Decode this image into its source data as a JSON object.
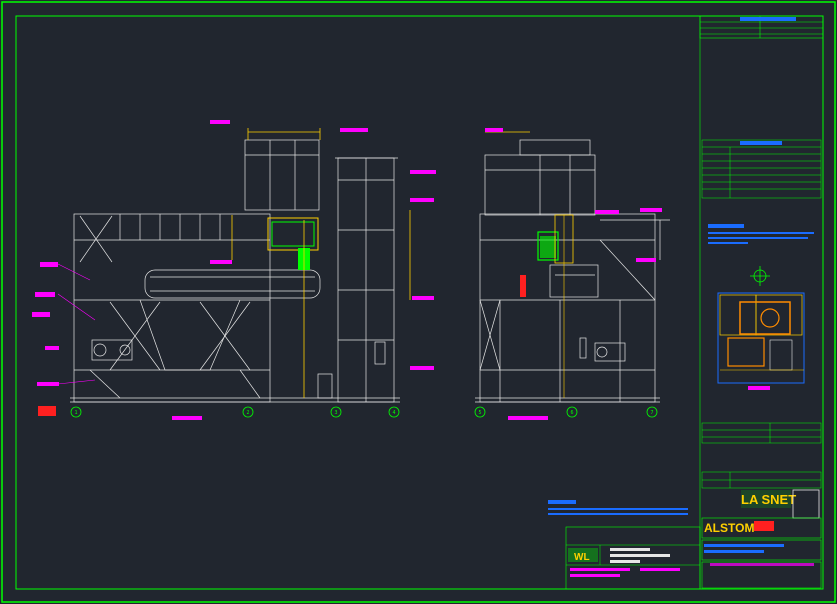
{
  "sheet": {
    "title_block": {
      "logo_brand": "LA SNET",
      "company": "ALSTOM",
      "drawing_ref": "WL"
    },
    "views": {
      "section_left": {
        "col_labels": [
          "1",
          "2",
          "3",
          "4"
        ]
      },
      "section_right": {
        "col_labels": [
          "5",
          "6",
          "7"
        ]
      }
    }
  },
  "colors": {
    "background": "#21262f",
    "frame": "#00ff00",
    "structure": "#e6e6e6",
    "highlight": "#ff00ff",
    "dimension": "#ffd000",
    "accent_green": "#00ff00",
    "accent_red": "#ff2020",
    "accent_blue": "#1a6cff",
    "accent_orange": "#ff8c00"
  },
  "icons": {
    "north_arrow": "crosshair-icon",
    "logo": "company-logo"
  }
}
